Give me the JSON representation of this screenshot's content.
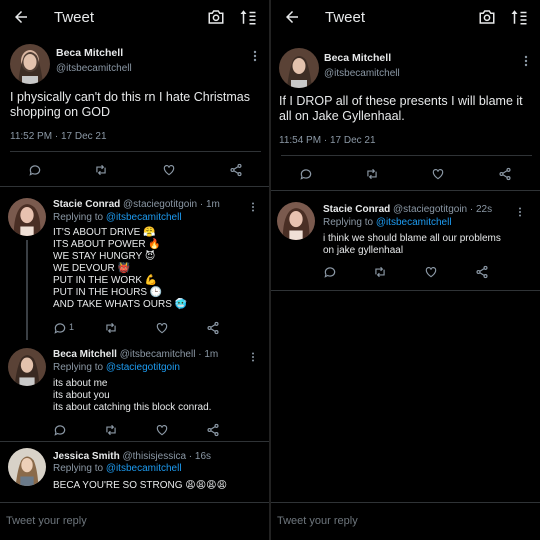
{
  "colors": {
    "background": "#000000",
    "text": "#e7e9ea",
    "muted": "#8b98a5",
    "link": "#1d9bf0",
    "divider": "#2f3336"
  },
  "left": {
    "header": {
      "title": "Tweet",
      "icons": [
        "back-arrow-icon",
        "camera-icon",
        "sort-icon"
      ]
    },
    "main_tweet": {
      "name": "Beca Mitchell",
      "handle": "@itsbecamitchell",
      "text": "I physically can't do this rn I hate Christmas shopping on GOD",
      "meta": "11:52 PM · 17 Dec 21"
    },
    "replies": [
      {
        "name": "Stacie Conrad",
        "handle": "@staciegotitgoin · 1m",
        "replying_prefix": "Replying to ",
        "replying_to": "@itsbecamitchell",
        "lines": [
          "IT'S ABOUT DRIVE 😤",
          "ITS ABOUT POWER 🔥",
          "WE STAY HUNGRY 😈",
          "WE DEVOUR 👹",
          "PUT IN THE WORK 💪",
          "PUT IN THE HOURS 🕒",
          "AND TAKE WHATS OURS 🥶"
        ],
        "reply_count": "1"
      },
      {
        "name": "Beca Mitchell",
        "handle": "@itsbecamitchell · 1m",
        "replying_prefix": "Replying to ",
        "replying_to": "@staciegotitgoin",
        "lines": [
          "its about me",
          "its about you",
          "its about catching this block conrad."
        ]
      },
      {
        "name": "Jessica Smith",
        "handle": "@thisisjessica · 16s",
        "replying_prefix": "Replying to ",
        "replying_to": "@itsbecamitchell",
        "lines": [
          "BECA YOU'RE SO STRONG 😩😩😩😩"
        ]
      }
    ],
    "compose_placeholder": "Tweet your reply"
  },
  "right": {
    "header": {
      "title": "Tweet",
      "icons": [
        "back-arrow-icon",
        "camera-icon",
        "sort-icon"
      ]
    },
    "main_tweet": {
      "name": "Beca Mitchell",
      "handle": "@itsbecamitchell",
      "text": "If I DROP all of these presents I will blame it all on Jake Gyllenhaal.",
      "meta": "11:54 PM · 17 Dec 21"
    },
    "replies": [
      {
        "name": "Stacie Conrad",
        "handle": "@staciegotitgoin · 22s",
        "replying_prefix": "Replying to ",
        "replying_to": "@itsbecamitchell",
        "lines": [
          "i think we should blame all our problems",
          "on jake gyllenhaal"
        ]
      }
    ],
    "compose_placeholder": "Tweet your reply"
  }
}
